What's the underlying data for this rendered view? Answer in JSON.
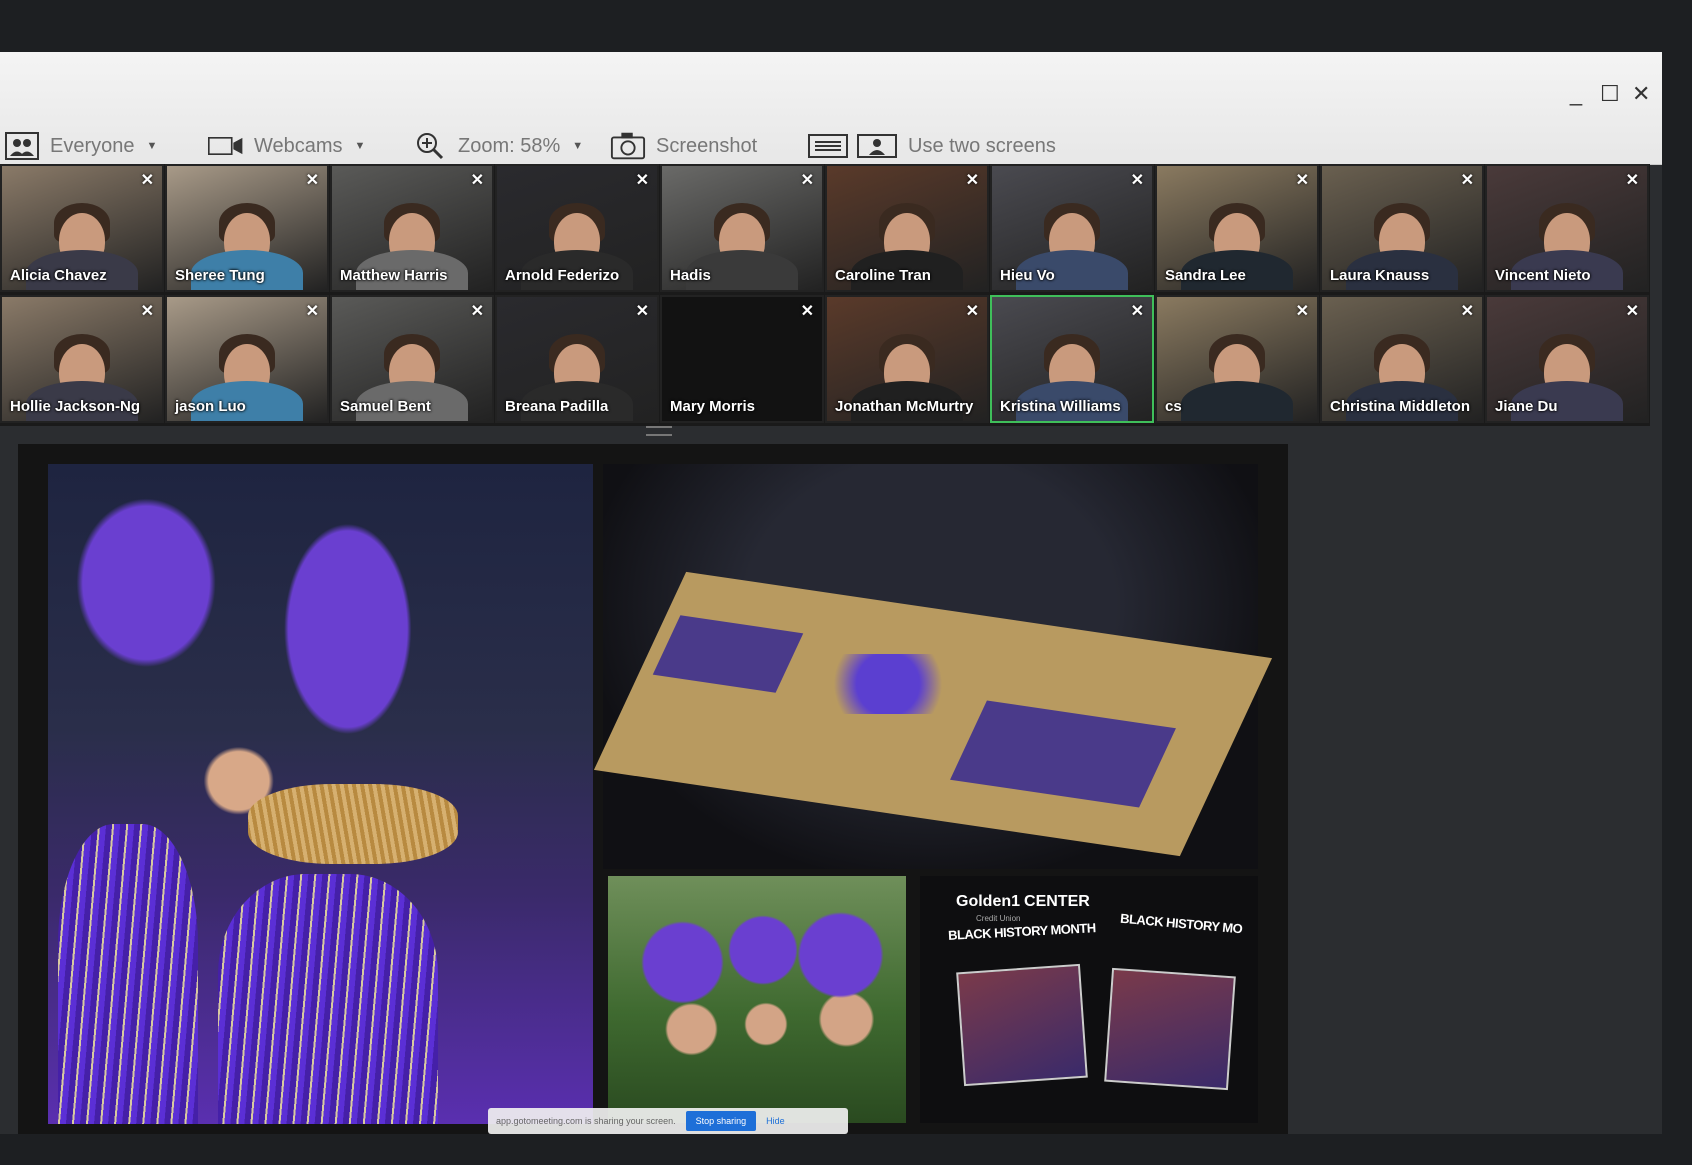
{
  "toolbar": {
    "audience": {
      "label": "Everyone",
      "icon": "people-icon"
    },
    "webcams": {
      "label": "Webcams",
      "icon": "webcam-icon"
    },
    "zoom": {
      "label": "Zoom: 58%",
      "icon": "zoom-in-icon"
    },
    "screenshot": {
      "label": "Screenshot",
      "icon": "camera-icon"
    },
    "two_screens": {
      "label": "Use two screens",
      "icon": "two-screens-icon"
    }
  },
  "window_controls": {
    "minimize": "_",
    "maximize": "☐",
    "close": "✕"
  },
  "participants": [
    {
      "name": "Alicia Chavez"
    },
    {
      "name": "Sheree Tung"
    },
    {
      "name": "Matthew Harris"
    },
    {
      "name": "Arnold Federizo"
    },
    {
      "name": "Hadis"
    },
    {
      "name": "Caroline Tran"
    },
    {
      "name": "Hieu Vo"
    },
    {
      "name": "Sandra Lee"
    },
    {
      "name": "Laura Knauss"
    },
    {
      "name": "Vincent Nieto"
    },
    {
      "name": "Hollie Jackson-Ng"
    },
    {
      "name": "jason Luo"
    },
    {
      "name": "Samuel Bent"
    },
    {
      "name": "Breana Padilla"
    },
    {
      "name": "Mary Morris"
    },
    {
      "name": "Jonathan McMurtry"
    },
    {
      "name": "Kristina Williams",
      "active": true
    },
    {
      "name": "cs"
    },
    {
      "name": "Christina Middleton"
    },
    {
      "name": "Jiane Du"
    }
  ],
  "close_glyph": "✕",
  "shared_content": {
    "promo": {
      "logo": "Golden1",
      "logo_suffix": "CENTER",
      "sub": "Credit Union",
      "title_1": "BLACK HISTORY MONTH",
      "title_2": "BLACK HISTORY MO"
    }
  },
  "share_bar": {
    "message": "app.gotomeeting.com is sharing your screen.",
    "stop_label": "Stop sharing",
    "hide_label": "Hide"
  },
  "colors": {
    "active_speaker": "#3fbf5a",
    "stop_button": "#1e6fd8",
    "court_paint": "#4a3a8a",
    "costume_purple": "#5b2fd6"
  }
}
